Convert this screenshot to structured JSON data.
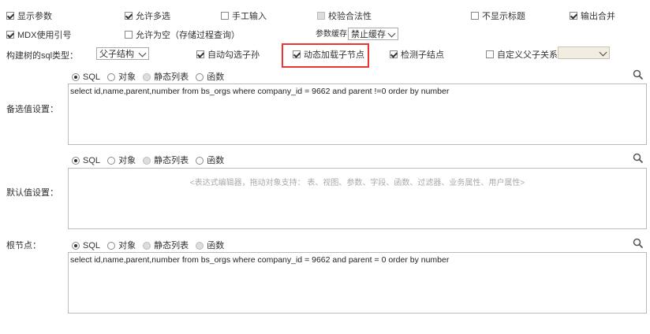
{
  "row1": {
    "show_params": "显示参数",
    "allow_multi": "允许多选",
    "manual_input": "手工输入",
    "validate": "校验合法性",
    "hide_title": "不显示标题",
    "merge_output": "输出合并"
  },
  "row2": {
    "mdx_ref": "MDX使用引号",
    "allow_empty": "允许为空（存储过程查询）",
    "param_cache_label": "参数缓存",
    "param_cache_value": "禁止缓存"
  },
  "row3": {
    "tree_sql_type_label": "构建树的sql类型：",
    "tree_sql_type_value": "父子结构",
    "auto_check_children": "自动勾选子孙",
    "dynamic_load": "动态加载子节点",
    "detect_child": "检测子结点",
    "custom_parent_child": "自定义父子关系"
  },
  "radio_options": [
    "SQL",
    "对象",
    "静态列表",
    "函数"
  ],
  "section1": {
    "label": "备选值设置：",
    "sql": "select id,name,parent,number from bs_orgs where company_id = 9662 and parent !=0 order by number"
  },
  "section2": {
    "label": "默认值设置：",
    "placeholder": "<表达式编辑器，拖动对象支持： 表、视图、参数、字段、函数、过滤器、业务属性、用户属性>"
  },
  "section3": {
    "label": "根节点：",
    "sql": "select id,name,parent,number from bs_orgs where company_id = 9662 and parent = 0 order by number"
  },
  "icons": {
    "search": "search-icon"
  }
}
